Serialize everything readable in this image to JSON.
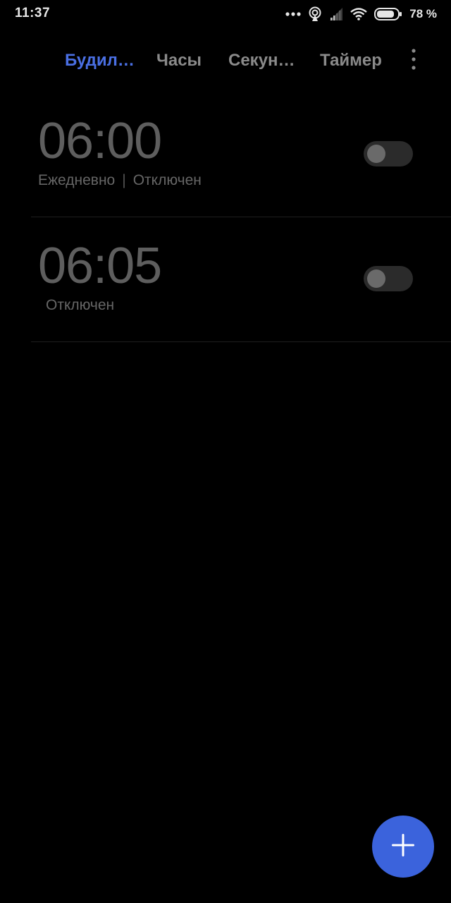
{
  "status_bar": {
    "time": "11:37",
    "battery_percent": "78 %",
    "icons": [
      "more-dots-icon",
      "hotspot-icon",
      "signal-icon",
      "wifi-icon",
      "battery-icon"
    ]
  },
  "tabs": [
    {
      "label": "Будил…",
      "active": true
    },
    {
      "label": "Часы",
      "active": false
    },
    {
      "label": "Секун…",
      "active": false
    },
    {
      "label": "Таймер",
      "active": false
    }
  ],
  "alarms": [
    {
      "time": "06:00",
      "repeat": "Ежедневно",
      "status": "Отключен",
      "enabled": false
    },
    {
      "time": "06:05",
      "repeat": "",
      "status": "Отключен",
      "enabled": false
    }
  ],
  "colors": {
    "background": "#000000",
    "accent": "#4a6fe3",
    "fab": "#3b63dc",
    "inactive_tab": "#8a8a8a",
    "alarm_time": "#5e5e5e",
    "toggle_track": "#2b2b2b",
    "toggle_knob": "#6a6a6a"
  },
  "fab": {
    "icon": "plus-icon"
  }
}
